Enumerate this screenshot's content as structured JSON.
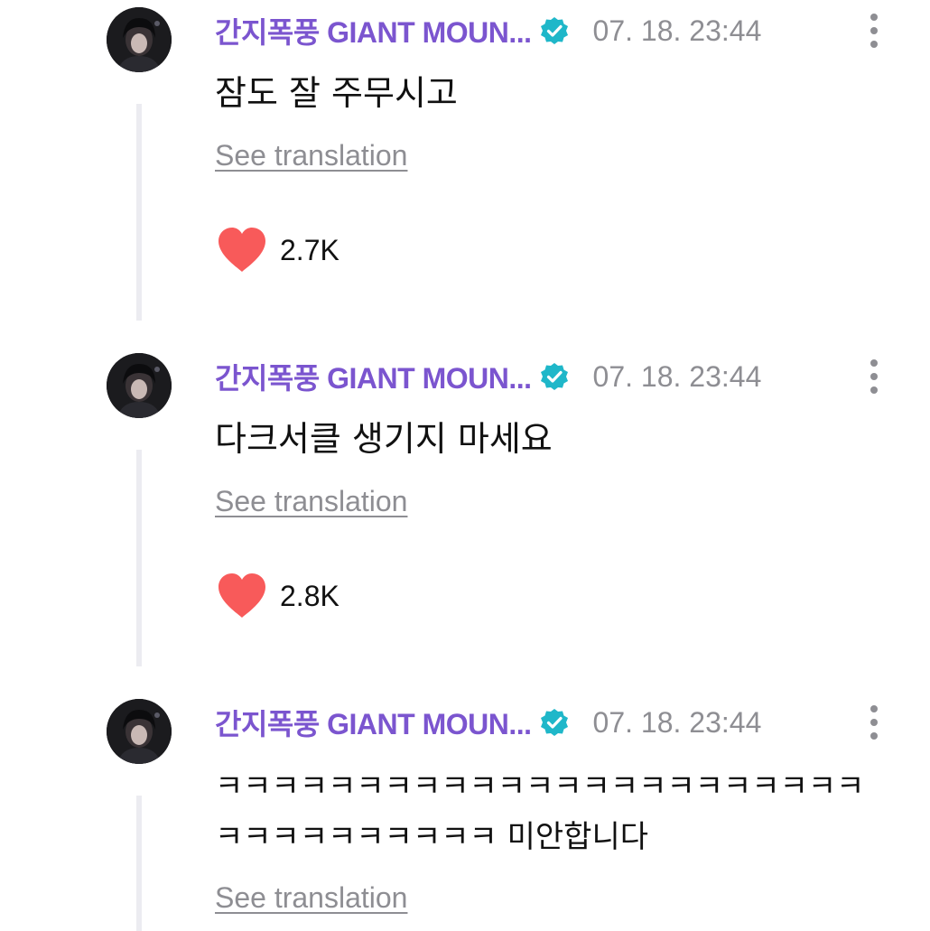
{
  "comments": [
    {
      "author": "간지폭풍 GIANT MOUN...",
      "timestamp": "07. 18. 23:44",
      "lines": [
        "잠도 잘 주무시고"
      ],
      "translate_label": "See translation",
      "likes": "2.7K"
    },
    {
      "author": "간지폭풍 GIANT MOUN...",
      "timestamp": "07. 18. 23:44",
      "lines": [
        "다크서클 생기지 마세요"
      ],
      "translate_label": "See translation",
      "likes": "2.8K"
    },
    {
      "author": "간지폭풍 GIANT MOUN...",
      "timestamp": "07. 18. 23:44",
      "lines": [
        "ㅋㅋㅋㅋㅋㅋㅋㅋㅋㅋㅋㅋㅋㅋㅋㅋㅋㅋㅋㅋㅋㅋㅋ",
        "ㅋㅋㅋㅋㅋㅋㅋㅋㅋㅋ 미안합니다"
      ],
      "translate_label": "See translation"
    }
  ],
  "icons": {
    "verified": "verified-badge-icon",
    "more": "more-vertical-icon",
    "like": "heart-icon"
  },
  "colors": {
    "author": "#7b55cf",
    "verified": "#1fb7c9",
    "heart": "#f85a5a",
    "muted": "#8e8e93",
    "thread_line": "#ececf1"
  }
}
